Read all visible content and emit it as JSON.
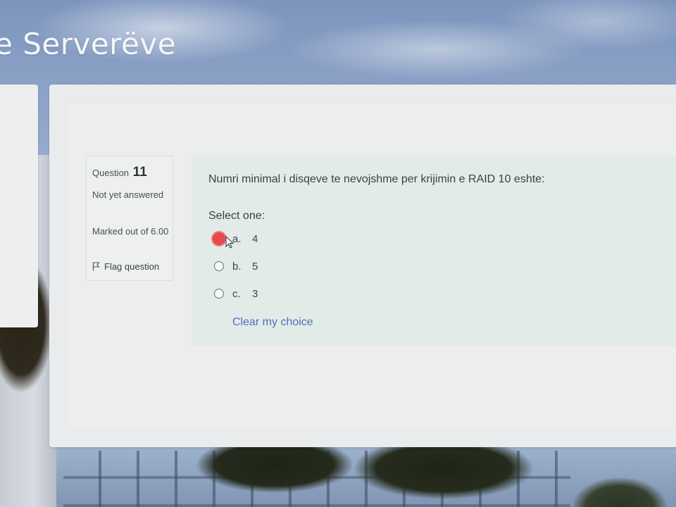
{
  "site": {
    "title": "e Serverëve"
  },
  "question": {
    "label": "Question",
    "number": "11",
    "state": "Not yet answered",
    "grade": "Marked out of 6.00",
    "flag_label": "Flag question",
    "text": "Numri minimal i disqeve te nevojshme per krijimin e RAID 10 eshte:",
    "prompt": "Select one:",
    "options": [
      {
        "letter": "a.",
        "value": "4",
        "selected": true
      },
      {
        "letter": "b.",
        "value": "5",
        "selected": false
      },
      {
        "letter": "c.",
        "value": "3",
        "selected": false
      }
    ],
    "clear_label": "Clear my choice"
  },
  "colors": {
    "selected_radio": "#e9484d",
    "link": "#4a72b8",
    "content_bg": "#e3ebe9"
  },
  "icons": {
    "flag": "flag-icon",
    "cursor": "mouse-pointer-icon"
  }
}
